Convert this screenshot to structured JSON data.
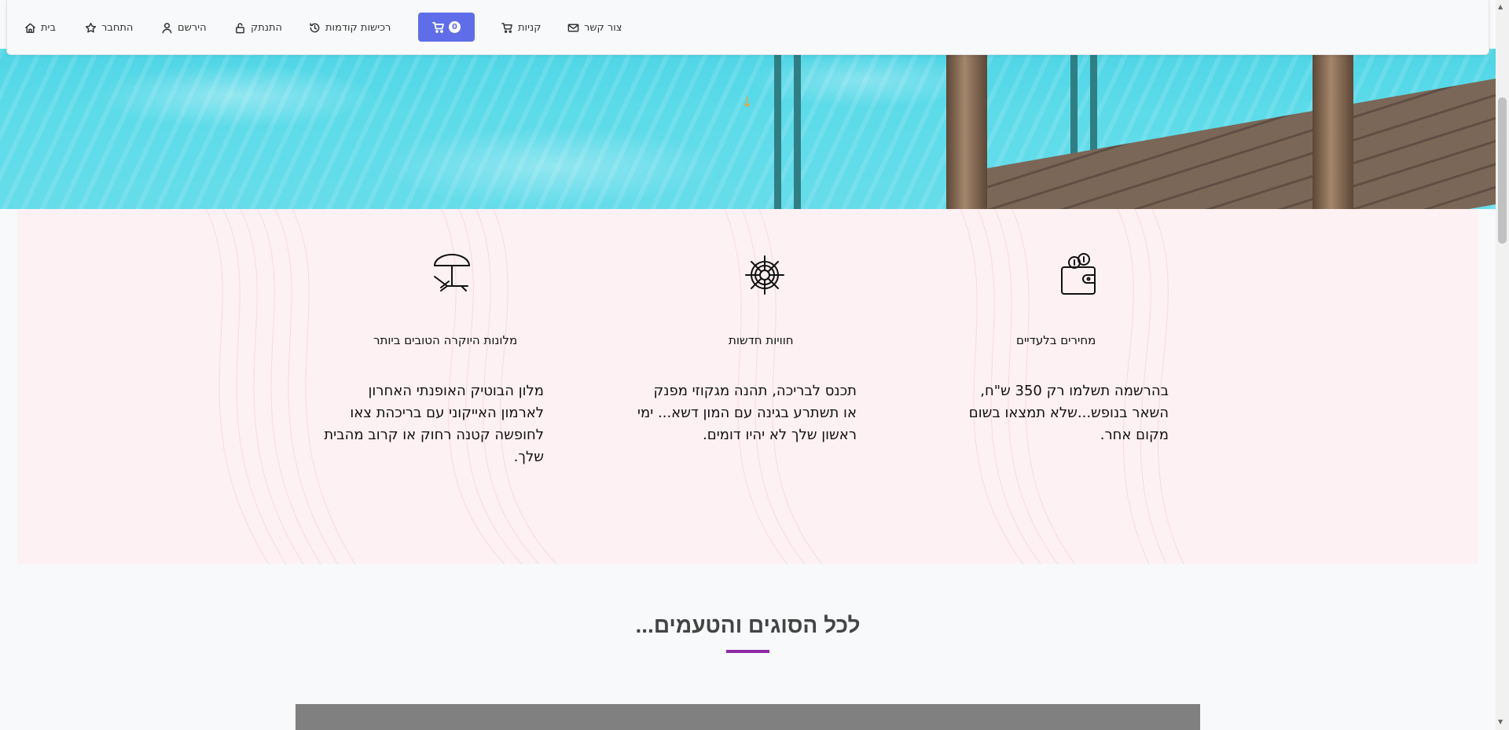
{
  "nav": {
    "home_label": "בית",
    "connect_label": "התחבר",
    "register_label": "הירשם",
    "logout_label": "התנתק",
    "previous_purchases_label": "רכישות קודמות",
    "cart_count": "0",
    "purchases_label": "קניות",
    "contact_label": "צור קשר",
    "accent_color": "#5f6ee8"
  },
  "features": [
    {
      "icon": "beach-umbrella-icon",
      "title": "מלונות היוקרה הטובים ביותר",
      "description": "מלון הבוטיק האופנתי האחרון לארמון האייקוני עם בריכהת צאו לחופשה קטנה רחוק או קרוב מהבית שלך."
    },
    {
      "icon": "ship-wheel-icon",
      "title": "חוויות חדשות",
      "description": "תכנס לבריכה, תהנה מגקוזי מפנק או תשתרע בגינה עם המון דשא... ימי ראשון שלך לא יהיו דומים."
    },
    {
      "icon": "wallet-coins-icon",
      "title": "מחירים בלעדיים",
      "description": "בהרשמה תשלמו רק 350 ש\"ח, השאר בנופש...שלא תמצאו בשום מקום אחר."
    }
  ],
  "section": {
    "title": "...לכל הסוגים והטעמים",
    "underline_color": "#8e2aa6"
  }
}
